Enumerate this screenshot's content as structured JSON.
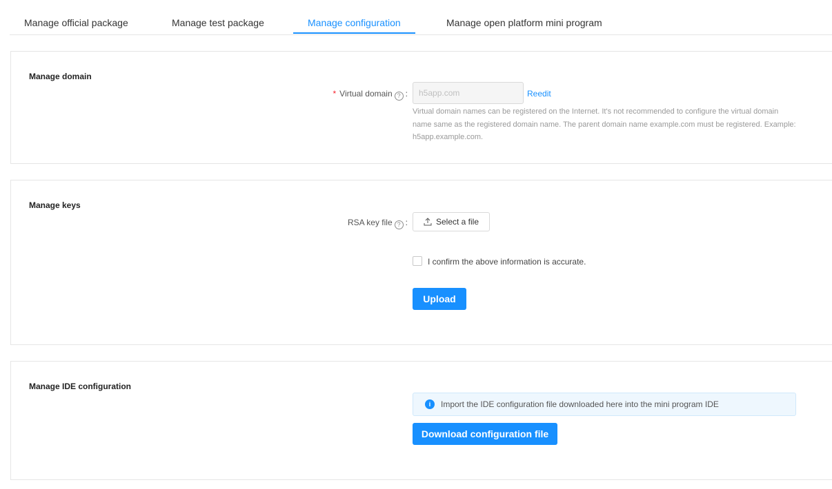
{
  "tabs": [
    {
      "label": "Manage official package",
      "active": false
    },
    {
      "label": "Manage test package",
      "active": false
    },
    {
      "label": "Manage configuration",
      "active": true
    },
    {
      "label": "Manage open platform mini program",
      "active": false
    }
  ],
  "domain_section": {
    "title": "Manage domain",
    "field_label": "Virtual domain",
    "required_mark": "*",
    "help_glyph": "?",
    "colon": ":",
    "input_value": "h5app.com",
    "reedit_label": "Reedit",
    "hint": "Virtual domain names can be registered on the Internet. It's not recommended to configure the virtual domain name same as the registered domain name. The parent domain name example.com must be registered. Example: h5app.example.com."
  },
  "keys_section": {
    "title": "Manage keys",
    "field_label": "RSA key file",
    "help_glyph": "?",
    "colon": ":",
    "select_file_label": "Select a file",
    "confirm_label": "I confirm the above information is accurate.",
    "confirm_checked": false,
    "upload_label": "Upload"
  },
  "ide_section": {
    "title": "Manage IDE configuration",
    "info_glyph": "i",
    "info_text": "Import the IDE configuration file downloaded here into the mini program IDE",
    "download_label": "Download configuration file"
  },
  "colors": {
    "accent": "#1890ff",
    "required": "#f5222d",
    "hint_text": "#999999",
    "banner_bg": "#eef7fe"
  }
}
